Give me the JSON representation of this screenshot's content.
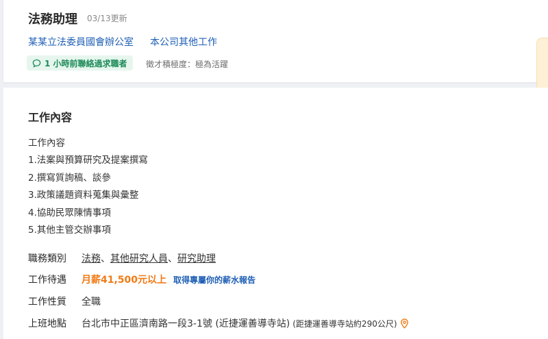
{
  "header": {
    "title": "法務助理",
    "updated": "03/13更新",
    "company": "某某立法委員國會辦公室",
    "other_jobs": "本公司其他工作",
    "contact_badge": "1 小時前聯絡過求職者",
    "activity": "徵才積極度：極為活躍"
  },
  "colors": {
    "link": "#1f5fb5",
    "salary": "#f07b16",
    "badge_bg": "#e6f6ee",
    "badge_text": "#1b8a57"
  },
  "content": {
    "section_title": "工作內容",
    "description": [
      "工作內容",
      "1.法案與預算研究及提案撰寫",
      "2.撰寫質詢稿、談參",
      "3.政策議題資料蒐集與彙整",
      "4.協助民眾陳情事項",
      "5.其他主管交辦事項"
    ],
    "category": {
      "label": "職務類別",
      "items": [
        "法務",
        "其他研究人員",
        "研究助理"
      ],
      "separator": "、"
    },
    "salary": {
      "label": "工作待遇",
      "value": "月薪41,500元以上",
      "report": "取得專屬你的薪水報告"
    },
    "nature": {
      "label": "工作性質",
      "value": "全職"
    },
    "location": {
      "label": "上班地點",
      "address": "台北市中正區濟南路一段3-1號 (近捷運善導寺站)",
      "distance": "(距捷運善導寺站約290公尺)",
      "icon": "location-pin-icon"
    }
  }
}
